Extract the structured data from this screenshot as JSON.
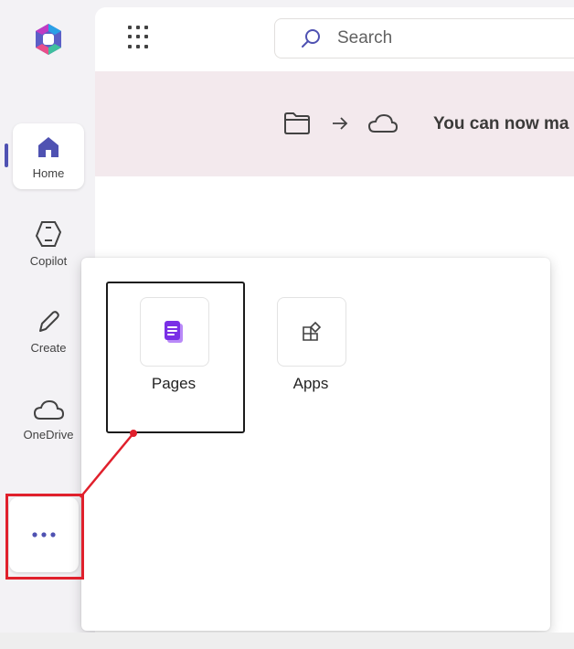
{
  "sidebar": {
    "logo": "microsoft-365-logo",
    "items": [
      {
        "label": "Home",
        "icon": "home-icon",
        "active": true
      },
      {
        "label": "Copilot",
        "icon": "copilot-icon",
        "active": false
      },
      {
        "label": "Create",
        "icon": "pen-icon",
        "active": false
      },
      {
        "label": "OneDrive",
        "icon": "cloud-icon",
        "active": false
      }
    ],
    "more": {
      "icon": "more-dots-icon"
    }
  },
  "header": {
    "apps_launcher": "waffle-icon",
    "search": {
      "placeholder": "Search",
      "icon": "search-icon"
    }
  },
  "banner": {
    "text": "You can now ma",
    "icons": [
      "folder-icon",
      "arrow-right-icon",
      "cloud-icon"
    ]
  },
  "popup": {
    "tiles": [
      {
        "label": "Pages",
        "icon": "pages-icon",
        "highlighted": true
      },
      {
        "label": "Apps",
        "icon": "apps-icon",
        "highlighted": false
      }
    ]
  },
  "annotation": {
    "color": "#e0202c",
    "outline_color": "#1b1b1b"
  },
  "colors": {
    "accent": "#4f52b2",
    "pages": "#8a3ffc",
    "banner_bg": "#f3e9ed"
  }
}
